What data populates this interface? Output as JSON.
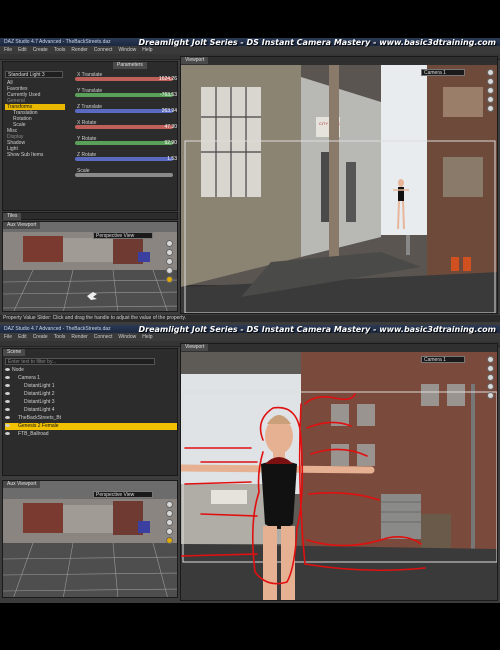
{
  "bg_top": "#000000",
  "shot1": {
    "app_title": "DAZ Studio 4.7 Advanced - TheBackStreets.daz",
    "overlay_title": "Dreamlight Jolt Series - DS Instant Camera Mastery - www.basic3dtraining.com",
    "menu": [
      "File",
      "Edit",
      "Create",
      "Tools",
      "Render",
      "Connect",
      "Window",
      "Help"
    ],
    "left_dropdown": "Standard Light 3",
    "left_items": [
      "All",
      "Favorites",
      "Currently Used",
      "General",
      "Transforms",
      "Translation",
      "Rotation",
      "Scale",
      "Misc",
      "Display",
      "Shadow",
      "Light",
      "Show Sub Items"
    ],
    "params_tab": "Parameters",
    "sliders": [
      {
        "label": "X Translate",
        "value": "1624.26",
        "color": "#c0605a"
      },
      {
        "label": "Y Translate",
        "value": "-763.53",
        "color": "#5aa05a"
      },
      {
        "label": "Z Translate",
        "value": "263.94",
        "color": "#5a6ac0"
      },
      {
        "label": "X Rotate",
        "value": "47.30",
        "color": "#c0605a"
      },
      {
        "label": "Y Rotate",
        "value": "92.90",
        "color": "#5aa05a"
      },
      {
        "label": "Z Rotate",
        "value": "1.53",
        "color": "#5a6ac0"
      },
      {
        "label": "Scale",
        "value": "",
        "color": "#8a8a8a"
      }
    ],
    "tiles_tab": "Tiles",
    "aux_tab": "Aux Viewport",
    "aux_view": "Perspective View",
    "viewport_tab": "Viewport",
    "camera_select": "Camera 1",
    "status": "Property Value Slider: Click and drag the handle to adjust the value of the property."
  },
  "shot2": {
    "app_title": "DAZ Studio 4.7 Advanced - TheBackStreets.daz",
    "overlay_title": "Dreamlight Jolt Series - DS Instant Camera Mastery - www.basic3dtraining.com",
    "menu": [
      "File",
      "Edit",
      "Create",
      "Tools",
      "Render",
      "Connect",
      "Window",
      "Help"
    ],
    "scene_tab": "Scene",
    "filter_placeholder": "Enter text to filter by...",
    "tree": [
      {
        "label": "Node",
        "selected": false,
        "indent": 0
      },
      {
        "label": "Camera 1",
        "selected": false,
        "indent": 1
      },
      {
        "label": "DistantLight 1",
        "selected": false,
        "indent": 2
      },
      {
        "label": "DistantLight 2",
        "selected": false,
        "indent": 2
      },
      {
        "label": "DistantLight 3",
        "selected": false,
        "indent": 2
      },
      {
        "label": "DistantLight 4",
        "selected": false,
        "indent": 2
      },
      {
        "label": "TheBackStreets_Bt",
        "selected": false,
        "indent": 1
      },
      {
        "label": "Genesis 2 Female",
        "selected": true,
        "indent": 1
      },
      {
        "label": "FTB_Ballroad",
        "selected": false,
        "indent": 1
      }
    ],
    "aux_tab": "Aux Viewport",
    "aux_view": "Perspective View",
    "viewport_tab": "Viewport",
    "camera_select": "Camera 1"
  }
}
